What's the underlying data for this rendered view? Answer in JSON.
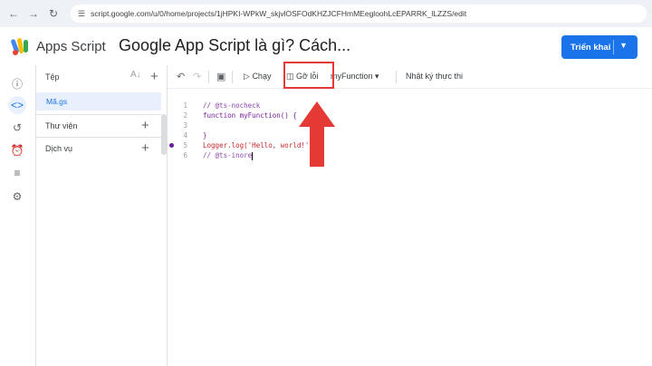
{
  "browser": {
    "url": "script.google.com/u/0/home/projects/1jHPKI-WPkW_skjvlOSFOdKHZJCFHmMEegloohLcEPARRK_lLZZS/edit"
  },
  "app": {
    "brand": "Apps Script",
    "project_title": "Google App Script là gì? Cách...",
    "deploy_label": "Triển khai"
  },
  "files_panel": {
    "header": "Tệp",
    "file_name": "Mã.gs",
    "libraries": "Thư viện",
    "services": "Dịch vụ"
  },
  "toolbar": {
    "run": "Chạy",
    "debug": "Gỡ lỗi",
    "function": "myFunction",
    "log": "Nhật ký thực thi"
  },
  "code": {
    "lines": [
      {
        "n": "1",
        "text": "// @ts-nocheck"
      },
      {
        "n": "2",
        "text": "function myFunction() {"
      },
      {
        "n": "3",
        "text": ""
      },
      {
        "n": "4",
        "text": "}"
      },
      {
        "n": "5",
        "text": "Logger.log('Hello, world!');"
      },
      {
        "n": "6",
        "text": "// @ts-inore"
      }
    ]
  },
  "colors": {
    "accent": "#1a73e8",
    "callout": "#e53935"
  }
}
